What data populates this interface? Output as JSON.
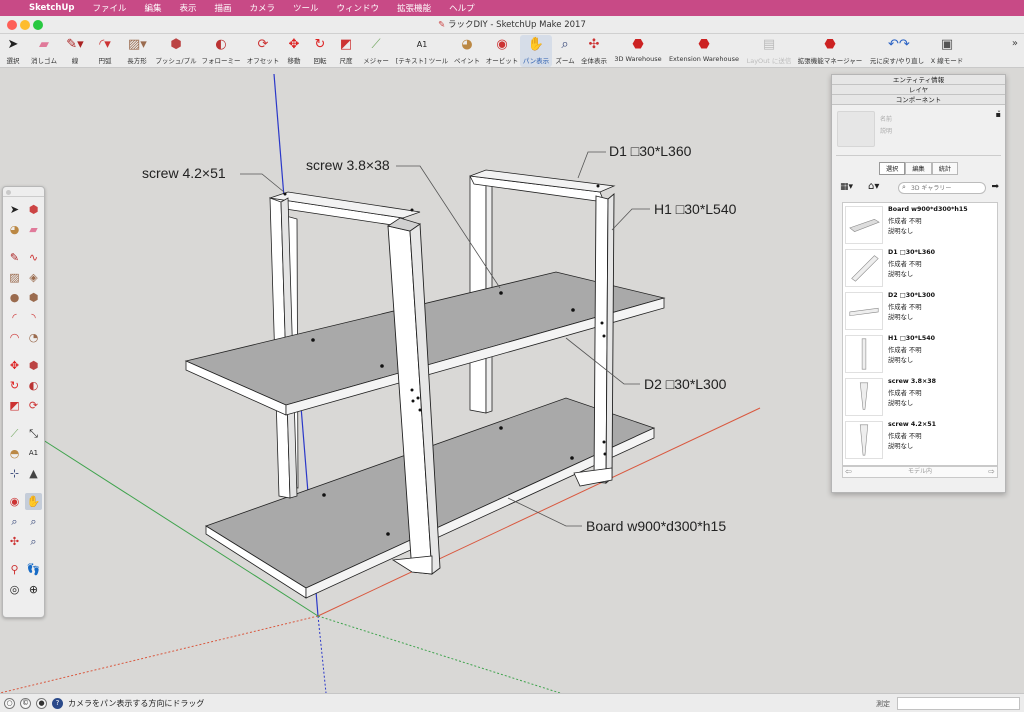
{
  "menubar": {
    "apple_icon": "apple-icon",
    "items": [
      "SketchUp",
      "ファイル",
      "編集",
      "表示",
      "描画",
      "カメラ",
      "ツール",
      "ウィンドウ",
      "拡張機能",
      "ヘルプ"
    ]
  },
  "window": {
    "title": "ラックDIY - SketchUp Make 2017"
  },
  "toolbar": {
    "items": [
      {
        "label": "選択",
        "icon": "arrow-icon"
      },
      {
        "label": "消しゴム",
        "icon": "eraser-icon"
      },
      {
        "label": "線",
        "icon": "pencil-icon"
      },
      {
        "label": "円弧",
        "icon": "arc-icon"
      },
      {
        "label": "長方形",
        "icon": "rectangle-icon"
      },
      {
        "label": "プッシュ/プル",
        "icon": "push-pull-icon"
      },
      {
        "label": "フォローミー",
        "icon": "follow-me-icon"
      },
      {
        "label": "オフセット",
        "icon": "offset-icon"
      },
      {
        "label": "移動",
        "icon": "move-icon"
      },
      {
        "label": "回転",
        "icon": "rotate-icon"
      },
      {
        "label": "尺度",
        "icon": "scale-icon"
      },
      {
        "label": "メジャー",
        "icon": "tape-measure-icon"
      },
      {
        "label": "[テキスト] ツール",
        "icon": "text-tool-icon"
      },
      {
        "label": "ペイント",
        "icon": "paint-bucket-icon"
      },
      {
        "label": "オービット",
        "icon": "orbit-icon"
      },
      {
        "label": "パン表示",
        "icon": "pan-icon"
      },
      {
        "label": "ズーム",
        "icon": "zoom-icon"
      },
      {
        "label": "全体表示",
        "icon": "zoom-extents-icon"
      },
      {
        "label": "3D Warehouse",
        "icon": "3d-warehouse-icon"
      },
      {
        "label": "Extension Warehouse",
        "icon": "extension-warehouse-icon"
      },
      {
        "label": "LayOut に送信",
        "icon": "send-to-layout-icon"
      },
      {
        "label": "拡張機能マネージャー",
        "icon": "extension-manager-icon"
      },
      {
        "label": "元に戻す/やり直し",
        "icon": "undo-redo-icon"
      },
      {
        "label": "X 線モード",
        "icon": "x-ray-icon"
      }
    ],
    "more_icon": "overflow-chevron-icon"
  },
  "annotations": [
    {
      "text": "screw 4.2×51"
    },
    {
      "text": "screw 3.8×38"
    },
    {
      "text": "D1 □30*L360"
    },
    {
      "text": "H1 □30*L540"
    },
    {
      "text": "D2 □30*L300"
    },
    {
      "text": "Board w900*d300*h15"
    }
  ],
  "panel": {
    "headers": [
      "エンティティ情報",
      "レイヤ",
      "コンポーネント"
    ],
    "selected_name": "名前",
    "selected_desc": "説明",
    "tabs": [
      "選択",
      "編集",
      "統計"
    ],
    "search_placeholder": "3D ギャラリー",
    "components": [
      {
        "name": "Board w900*d300*h15",
        "author": "作成者 不明",
        "desc": "説明なし"
      },
      {
        "name": "D1 □30*L360",
        "author": "作成者 不明",
        "desc": "説明なし"
      },
      {
        "name": "D2 □30*L300",
        "author": "作成者 不明",
        "desc": "説明なし"
      },
      {
        "name": "H1 □30*L540",
        "author": "作成者 不明",
        "desc": "説明なし"
      },
      {
        "name": "screw 3.8×38",
        "author": "作成者 不明",
        "desc": "説明なし"
      },
      {
        "name": "screw 4.2×51",
        "author": "作成者 不明",
        "desc": "説明なし"
      }
    ],
    "footer": "モデル内"
  },
  "status": {
    "text": "カメラをパン表示する方向にドラッグ",
    "measure_label": "測定"
  },
  "colors": {
    "menubar": "#c84a86",
    "axis_red": "#d9583f",
    "axis_green": "#3fa34d",
    "axis_blue": "#2b38c9",
    "board_top": "#a9a9a9",
    "board_edge": "#ffffff",
    "viewport_bg": "#d9d8d6"
  }
}
